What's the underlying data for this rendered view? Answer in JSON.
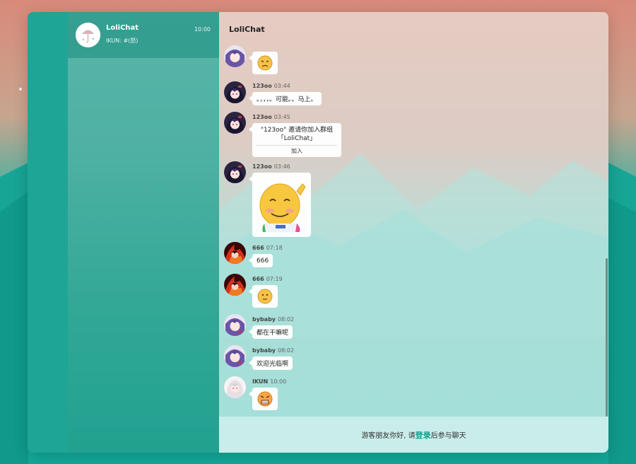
{
  "sidebar": {
    "conversation": {
      "name": "LoliChat",
      "time": "10:00",
      "preview": "IKUN: #(怒)"
    }
  },
  "chat": {
    "title": "LoliChat",
    "messages": [
      {
        "type": "emoji",
        "avatar": "purple-hair-avatar",
        "emoji": "angry-face"
      },
      {
        "type": "text",
        "nick": "123oo",
        "time": "03:44",
        "avatar": "dark-hair-avatar",
        "text": "。，，，。可能。。马上。"
      },
      {
        "type": "invite",
        "nick": "123oo",
        "time": "03:45",
        "avatar": "dark-hair-avatar",
        "text": "\"123oo\" 邀请你加入群组「LoliChat」",
        "action": "加入"
      },
      {
        "type": "sticker",
        "nick": "123oo",
        "time": "03:46",
        "avatar": "dark-hair-avatar",
        "sticker": "waving-smiley-sticker"
      },
      {
        "type": "text",
        "nick": "666",
        "time": "07:18",
        "avatar": "red-flame-avatar",
        "text": "666"
      },
      {
        "type": "emoji",
        "nick": "666",
        "time": "07:19",
        "avatar": "red-flame-avatar",
        "emoji": "neutral-face"
      },
      {
        "type": "text",
        "nick": "bybaby",
        "time": "08:02",
        "avatar": "purple-hair-avatar",
        "text": "都在干嘛呢"
      },
      {
        "type": "text",
        "nick": "bybaby",
        "time": "08:02",
        "avatar": "purple-hair-avatar",
        "text": "欢迎光临啊"
      },
      {
        "type": "emoji",
        "nick": "IKUN",
        "time": "10:00",
        "avatar": "white-hair-avatar",
        "emoji": "angry-face"
      }
    ]
  },
  "footer": {
    "before": "游客朋友你好, 请",
    "link": "登录",
    "after": "后参与聊天"
  },
  "colors": {
    "accent": "#12a08f",
    "rail": "#1fa595"
  }
}
